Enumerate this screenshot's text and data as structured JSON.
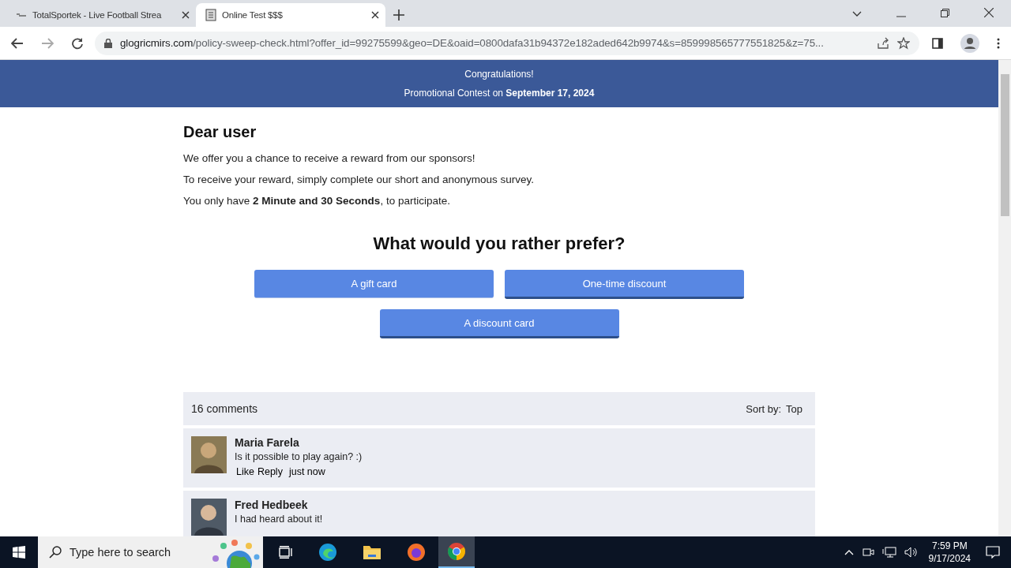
{
  "browser": {
    "tabs": [
      {
        "title": "TotalSportek - Live Football Strea",
        "selected": false
      },
      {
        "title": "Online Test $$$",
        "selected": true
      }
    ],
    "url_host": "glogricmirs.com",
    "url_path": "/policy-sweep-check.html?offer_id=99275599&geo=DE&oaid=0800dafa31b94372e182aded642b9974&s=859998565777551825&z=75..."
  },
  "banner": {
    "line1": "Congratulations!",
    "line2": "Promotional Contest on **September 17, 2024**"
  },
  "greeting": "Dear user",
  "paragraphs": [
    "We offer you a chance to receive a reward from our sponsors!",
    "To receive your reward, simply complete our short and anonymous survey.",
    "You only have **2 Minute and 30 Seconds**, to participate."
  ],
  "question": "What would you rather prefer?",
  "choices": [
    "A gift card",
    "One-time discount",
    "A discount card"
  ],
  "comments": {
    "count": "16 comments",
    "sort_label": "Sort by:",
    "sort_value": "Top",
    "items": [
      {
        "name": "Maria Farela",
        "text": "Is it possible to play again? :)",
        "like": "Like",
        "reply": "Reply",
        "time": "just now"
      },
      {
        "name": "Fred Hedbeek",
        "text": "I had heard about it!"
      }
    ]
  },
  "taskbar": {
    "search_placeholder": "Type here to search",
    "time": "7:59 PM",
    "date": "9/17/2024"
  }
}
